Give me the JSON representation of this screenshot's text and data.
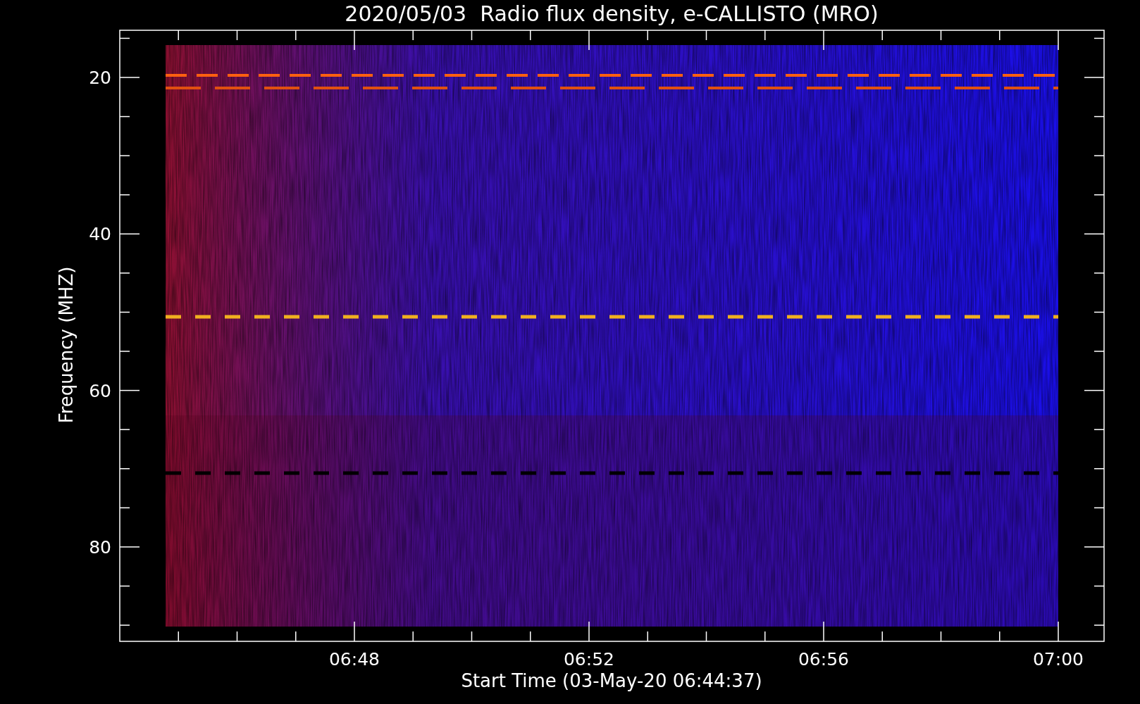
{
  "title": "2020/05/03  Radio flux density, e-CALLISTO (MRO)",
  "y_axis": {
    "label": "Frequency (MHZ)",
    "ticks": [
      "20",
      "40",
      "60",
      "80"
    ]
  },
  "x_axis": {
    "label": "Start Time (03-May-20 06:44:37)",
    "ticks": [
      "06:48",
      "06:52",
      "06:56",
      "07:00"
    ]
  }
}
